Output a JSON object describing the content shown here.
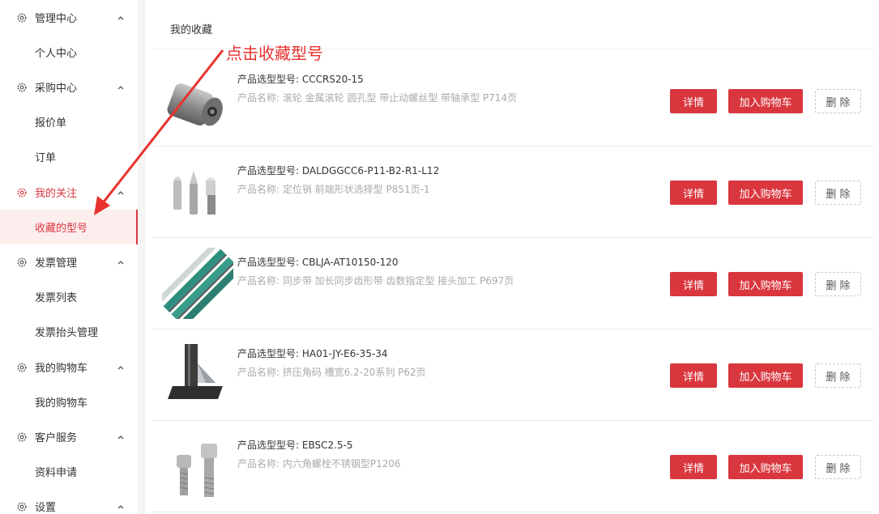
{
  "sidebar": {
    "groups": [
      {
        "label": "管理中心",
        "items": [
          "个人中心"
        ]
      },
      {
        "label": "采购中心",
        "items": [
          "报价单",
          "订单"
        ]
      },
      {
        "label": "我的关注",
        "items": [
          "收藏的型号"
        ]
      },
      {
        "label": "发票管理",
        "items": [
          "发票列表",
          "发票抬头管理"
        ]
      },
      {
        "label": "我的购物车",
        "items": [
          "我的购物车"
        ]
      },
      {
        "label": "客户服务",
        "items": [
          "资料申请"
        ]
      },
      {
        "label": "设置",
        "items": []
      }
    ],
    "active_group": "我的关注",
    "selected_item": "收藏的型号"
  },
  "main": {
    "title": "我的收藏",
    "annotation": "点击收藏型号",
    "buttons": {
      "detail": "详情",
      "add_to_cart": "加入购物车",
      "delete": "删 除"
    },
    "products": [
      {
        "model": "产品选型型号: CCCRS20-15",
        "name": "产品名称: 滚轮 金属滚轮 圆孔型 带止动螺丝型 带轴承型 P714页",
        "image": "roller-image"
      },
      {
        "model": "产品选型型号: DALDGGCC6-P11-B2-R1-L12",
        "name": "产品名称: 定位销 前端形状选择型 P851页-1",
        "image": "locating-pin-image"
      },
      {
        "model": "产品选型型号: CBLJA-AT10150-120",
        "name": "产品名称: 同步带 加长同步齿形带 齿数指定型 接头加工 P697页",
        "image": "timing-belt-image"
      },
      {
        "model": "产品选型型号: HA01-JY-E6-35-34",
        "name": "产品名称: 挤压角码 槽宽6.2-20系列 P62页",
        "image": "corner-bracket-image"
      },
      {
        "model": "产品选型型号: EBSC2.5-5",
        "name": "产品名称: 内六角螺栓不锈钢型P1206",
        "image": "hex-bolt-image"
      }
    ]
  },
  "colors": {
    "accent": "#d9363e",
    "annotation": "#e8322e"
  }
}
